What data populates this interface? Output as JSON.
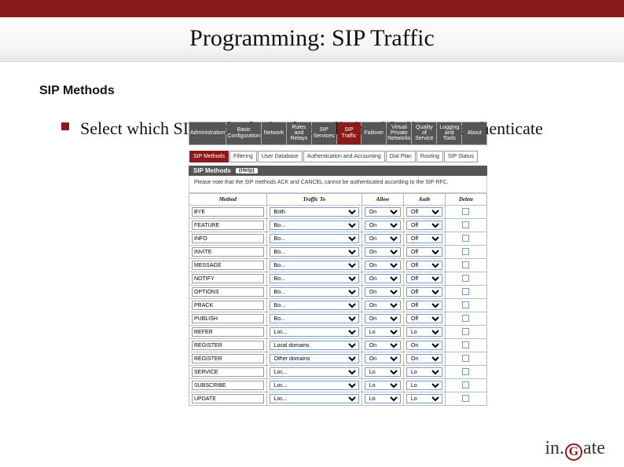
{
  "slide": {
    "title": "Programming: SIP Traffic",
    "section": "SIP Methods",
    "bullet": "Select which SIP methods the firewall should allow & authenticate"
  },
  "top_tabs": [
    {
      "label": "Administration",
      "active": false
    },
    {
      "label": "Basic Configuration",
      "active": false
    },
    {
      "label": "Network",
      "active": false
    },
    {
      "label": "Rules and Relays",
      "active": false
    },
    {
      "label": "SIP Services",
      "active": false
    },
    {
      "label": "SIP Traffic",
      "active": true
    },
    {
      "label": "Failover",
      "active": false
    },
    {
      "label": "Virtual Private Networks",
      "active": false
    },
    {
      "label": "Quality of Service",
      "active": false
    },
    {
      "label": "Logging and Tools",
      "active": false
    },
    {
      "label": "About",
      "active": false
    }
  ],
  "sub_tabs": [
    {
      "label": "SIP Methods",
      "active": true
    },
    {
      "label": "Filtering",
      "active": false
    },
    {
      "label": "User Database",
      "active": false
    },
    {
      "label": "Authentication and Accounting",
      "active": false
    },
    {
      "label": "Dial Plan",
      "active": false
    },
    {
      "label": "Routing",
      "active": false
    },
    {
      "label": "SIP Status",
      "active": false
    }
  ],
  "panel": {
    "title": "SIP Methods",
    "help": "(Help)",
    "note": "Please note that the SIP methods ACK and CANCEL cannot be authenticated according to the SIP RFC."
  },
  "columns": {
    "method": "Method",
    "traffic_to": "Traffic To",
    "allow": "Allow",
    "auth": "Auth",
    "delete": "Delete"
  },
  "rows": [
    {
      "method": "BYE",
      "traffic": "Both",
      "allow": "On",
      "auth": "Off"
    },
    {
      "method": "FEATURE",
      "traffic": "Bo...",
      "allow": "On",
      "auth": "Off"
    },
    {
      "method": "INFO",
      "traffic": "Bo...",
      "allow": "On",
      "auth": "Off"
    },
    {
      "method": "INVITE",
      "traffic": "Bo...",
      "allow": "On",
      "auth": "Off"
    },
    {
      "method": "MESSAGE",
      "traffic": "Bo...",
      "allow": "On",
      "auth": "Off"
    },
    {
      "method": "NOTIFY",
      "traffic": "Bo...",
      "allow": "On",
      "auth": "Off"
    },
    {
      "method": "OPTIONS",
      "traffic": "Bo...",
      "allow": "On",
      "auth": "Off"
    },
    {
      "method": "PRACK",
      "traffic": "Bo...",
      "allow": "On",
      "auth": "Off"
    },
    {
      "method": "PUBLISH",
      "traffic": "Bo...",
      "allow": "On",
      "auth": "Off"
    },
    {
      "method": "REFER",
      "traffic": "Loc...",
      "allow": "Lo",
      "auth": "Lo"
    },
    {
      "method": "REGISTER",
      "traffic": "Local domains",
      "allow": "On",
      "auth": "On"
    },
    {
      "method": "REGISTER",
      "traffic": "Other domains",
      "allow": "On",
      "auth": "On"
    },
    {
      "method": "SERVICE",
      "traffic": "Loc...",
      "allow": "Lo",
      "auth": "Lo"
    },
    {
      "method": "SUBSCRIBE",
      "traffic": "Loc...",
      "allow": "Lo",
      "auth": "Lo"
    },
    {
      "method": "UPDATE",
      "traffic": "Loc...",
      "allow": "Lo",
      "auth": "Lo"
    }
  ],
  "logo": {
    "pre": "in.",
    "g": "G",
    "post": "ate"
  }
}
